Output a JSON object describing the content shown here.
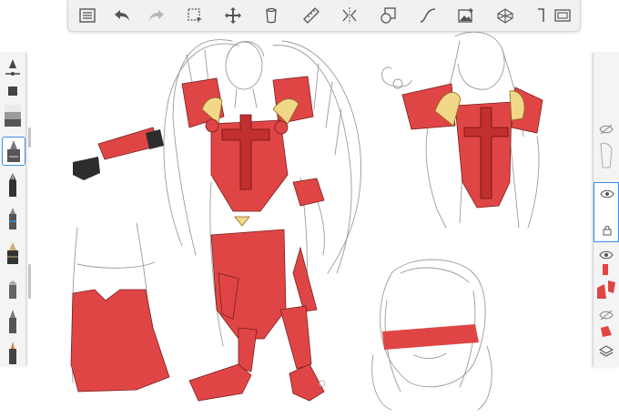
{
  "app": {
    "accent_color": "#3a8ee6",
    "artwork_red": "#e04545"
  },
  "toolbar": {
    "items": [
      {
        "name": "gallery-icon"
      },
      {
        "name": "undo-icon"
      },
      {
        "name": "redo-icon"
      },
      {
        "name": "selection-icon"
      },
      {
        "name": "transform-icon"
      },
      {
        "name": "copy-layer-icon"
      },
      {
        "name": "ruler-icon"
      },
      {
        "name": "symmetry-icon"
      },
      {
        "name": "shapes-icon"
      },
      {
        "name": "curve-icon"
      },
      {
        "name": "image-icon"
      },
      {
        "name": "perspective-icon"
      },
      {
        "name": "text-icon"
      },
      {
        "name": "fullscreen-icon"
      }
    ]
  },
  "brush_palette": {
    "selected_index": 3,
    "items": [
      "brush-size-slider",
      "brush-opacity-slider",
      "color-swatch",
      "pencil-brush",
      "fineliner-brush",
      "marker-brush",
      "airbrush-brush",
      "paintbrush-brush",
      "pen-brush",
      "ink-brush"
    ]
  },
  "layers_panel": {
    "active_index": 1,
    "items": [
      {
        "name": "layer-top",
        "visible": false
      },
      {
        "name": "layer-sketch",
        "visible": true
      },
      {
        "name": "layer-color",
        "visible": true
      },
      {
        "name": "layer-base",
        "visible": false
      }
    ]
  }
}
